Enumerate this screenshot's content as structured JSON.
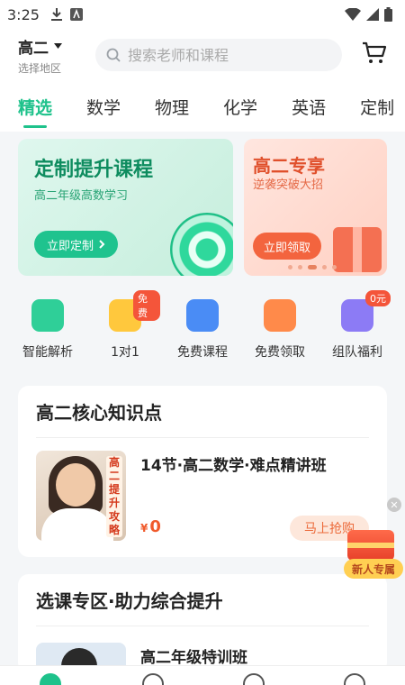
{
  "status_bar": {
    "time": "3:25"
  },
  "header": {
    "grade": "高二",
    "region_label": "选择地区",
    "search_placeholder": "搜索老师和课程"
  },
  "tabs": [
    "精选",
    "数学",
    "物理",
    "化学",
    "英语",
    "定制"
  ],
  "active_tab": "精选",
  "banners": [
    {
      "title": "定制提升课程",
      "subtitle": "高二年级高数学习",
      "button": "立即定制"
    },
    {
      "title": "高二专享",
      "subtitle": "逆袭突破大招",
      "button": "立即领取"
    }
  ],
  "quick_entries": [
    {
      "label": "智能解析",
      "badge": "",
      "color": "#2fcf98"
    },
    {
      "label": "1对1",
      "badge": "免费",
      "color": "#ffc83d"
    },
    {
      "label": "免费课程",
      "badge": "",
      "color": "#4a8cf5"
    },
    {
      "label": "免费领取",
      "badge": "",
      "color": "#ff8a4a"
    },
    {
      "label": "组队福利",
      "badge": "0元",
      "color": "#8c7bf5"
    }
  ],
  "section1": {
    "title": "高二核心知识点",
    "course": {
      "title": "14节·高二数学·难点精讲班",
      "thumb_text": "高二提升攻略",
      "currency": "¥",
      "price": "0",
      "cta": "马上抢购"
    }
  },
  "section2": {
    "title": "选课专区·助力综合提升",
    "course_title": "高二年级特训班"
  },
  "promo": {
    "label": "新人专属"
  },
  "colors": {
    "accent": "#1ec28b",
    "orange": "#f05a2b"
  }
}
